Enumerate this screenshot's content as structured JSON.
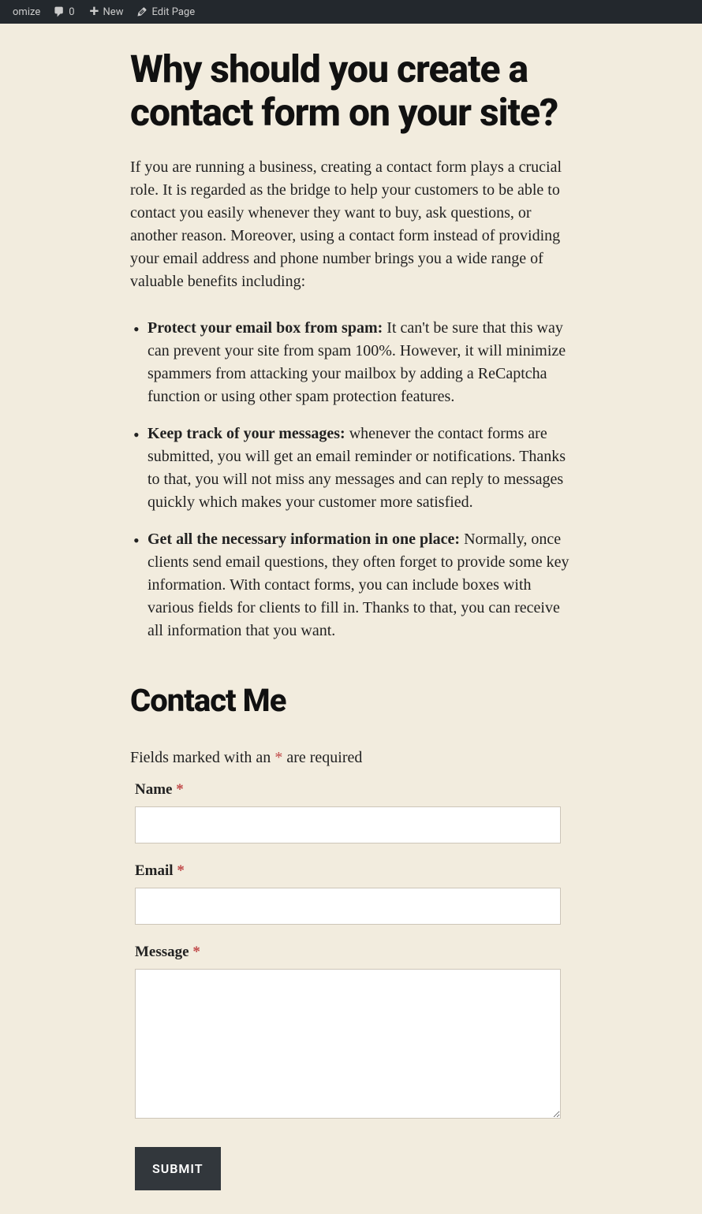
{
  "adminBar": {
    "customize": "omize",
    "commentsCount": "0",
    "new": "New",
    "editPage": "Edit Page"
  },
  "heading": "Why should you create a contact form on your site?",
  "intro": "If you are running a business, creating a contact form plays a crucial role. It is regarded as the bridge to help your customers to be able to contact you easily whenever they want to buy, ask questions, or another reason. Moreover, using a contact form instead of providing your email address and phone number brings you a wide range of valuable benefits including:",
  "bullets": [
    {
      "title": "Protect your email box from spam:",
      "text": " It can't be sure that this way can prevent your site from spam 100%. However, it will minimize spammers from attacking your mailbox by adding a ReCaptcha function or using other spam protection features."
    },
    {
      "title": "Keep track of your messages:",
      "text": " whenever the contact forms are submitted, you will get an email reminder or notifications. Thanks to that, you will not miss any messages and can reply to messages quickly which makes your customer more satisfied."
    },
    {
      "title": "Get all the necessary information in one place:",
      "text": " Normally, once clients send email questions, they often forget to provide some key information. With contact forms, you can include boxes with various fields for clients to fill in. Thanks to that, you can receive all information that you want."
    }
  ],
  "contactHeading": "Contact Me",
  "requiredNoteBefore": "Fields marked with an ",
  "requiredNoteAsterisk": "*",
  "requiredNoteAfter": " are required",
  "form": {
    "nameLabel": "Name ",
    "emailLabel": "Email ",
    "messageLabel": "Message ",
    "asterisk": "*",
    "submitLabel": "SUBMIT"
  }
}
